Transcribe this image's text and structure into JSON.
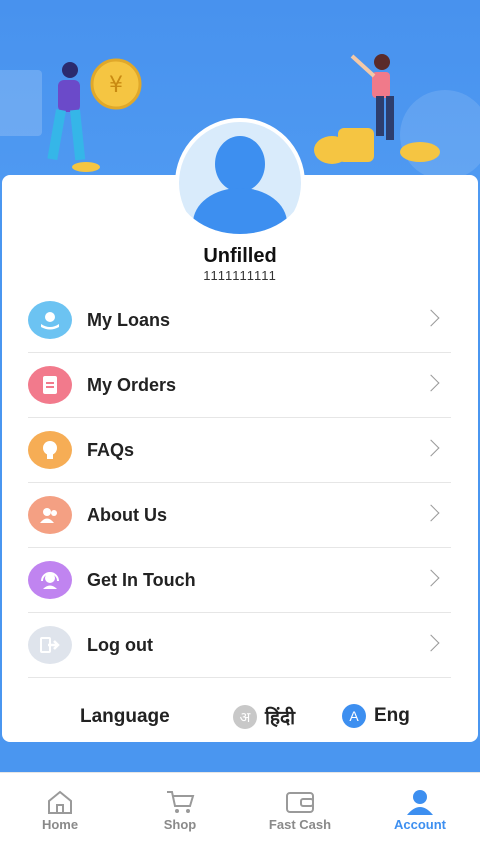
{
  "profile": {
    "name": "Unfilled",
    "phone": "1111111111"
  },
  "menu": {
    "items": [
      {
        "label": "My Loans",
        "icon": "hand-coin-icon",
        "color": "#6cc3f2"
      },
      {
        "label": "My Orders",
        "icon": "document-icon",
        "color": "#f27a8c"
      },
      {
        "label": "FAQs",
        "icon": "lightbulb-icon",
        "color": "#f6ad55"
      },
      {
        "label": "About Us",
        "icon": "people-icon",
        "color": "#f4a083"
      },
      {
        "label": "Get In Touch",
        "icon": "headset-icon",
        "color": "#c084f0"
      },
      {
        "label": "Log out",
        "icon": "logout-icon",
        "color": "#dfe4ec"
      }
    ]
  },
  "language": {
    "title": "Language",
    "options": [
      {
        "badge": "अ",
        "label": "हिंदी",
        "color": "#c8c8c8"
      },
      {
        "badge": "A",
        "label": "Eng",
        "color": "#3d8ff0"
      }
    ]
  },
  "tabbar": {
    "tabs": [
      {
        "label": "Home",
        "icon": "home-icon",
        "active": false
      },
      {
        "label": "Shop",
        "icon": "cart-icon",
        "active": false
      },
      {
        "label": "Fast Cash",
        "icon": "wallet-icon",
        "active": false
      },
      {
        "label": "Account",
        "icon": "account-icon",
        "active": true
      }
    ]
  },
  "colors": {
    "accent": "#3d8ff0",
    "background": "#4a96f0"
  }
}
